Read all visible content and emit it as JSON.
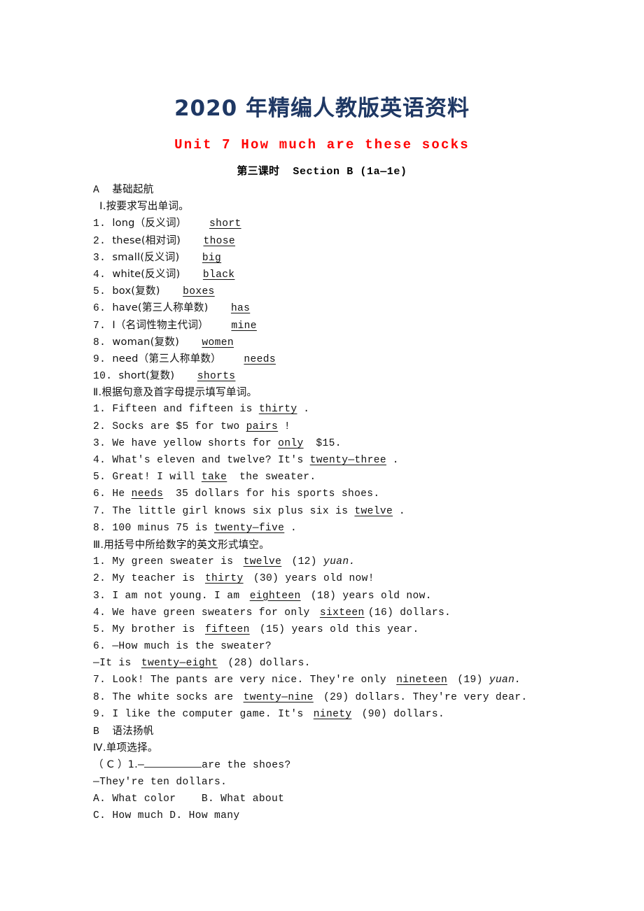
{
  "banner": "2020 年精编人教版英语资料",
  "unit_title": "Unit 7 How much are these socks",
  "subtitle_cn": "第三课时",
  "subtitle_en": "Section B (1a—1e)",
  "colors": {
    "banner": "#1f3864",
    "title": "#ff0000",
    "text": "#111111"
  },
  "section_a": {
    "letter": "A",
    "name": "基础起航"
  },
  "part1": {
    "heading_num": "Ⅰ",
    "heading": ".按要求写出单词。",
    "items": [
      {
        "num": "1.",
        "prompt": "long（反义词）",
        "answer": "short"
      },
      {
        "num": "2.",
        "prompt": "these(相对词)",
        "answer": "those"
      },
      {
        "num": "3.",
        "prompt": "small(反义词)",
        "answer": "big"
      },
      {
        "num": "4.",
        "prompt": "white(反义词)",
        "answer": "black"
      },
      {
        "num": "5.",
        "prompt": "box(复数)",
        "answer": "boxes"
      },
      {
        "num": "6.",
        "prompt": "have(第三人称单数)",
        "answer": "has"
      },
      {
        "num": "7.",
        "prompt": "I（名词性物主代词）",
        "answer": "mine"
      },
      {
        "num": "8.",
        "prompt": "woman(复数)",
        "answer": "women"
      },
      {
        "num": "9.",
        "prompt": "need（第三人称单数）",
        "answer": "needs"
      },
      {
        "num": "10.",
        "prompt": "short(复数)",
        "answer": "shorts"
      }
    ]
  },
  "part2": {
    "heading_num": "Ⅱ",
    "heading": ".根据句意及首字母提示填写单词。",
    "items": [
      {
        "num": "1.",
        "before": "Fifteen and fifteen is ",
        "answer": "thirty",
        "after": "."
      },
      {
        "num": "2.",
        "before": "Socks are $5 for two ",
        "answer": "pairs",
        "after": "!"
      },
      {
        "num": "3.",
        "before": "We have yellow shorts for ",
        "answer": "only",
        "after": " $15."
      },
      {
        "num": "4.",
        "before": "What's eleven and twelve? It's ",
        "answer": "twenty—three",
        "after": "."
      },
      {
        "num": "5.",
        "before": "Great! I will ",
        "answer": "take",
        "after": " the sweater."
      },
      {
        "num": "6.",
        "before": "He ",
        "answer": "needs",
        "after": " 35 dollars for his sports shoes."
      },
      {
        "num": "7.",
        "before": "The little girl knows six plus six is ",
        "answer": "twelve",
        "after": "."
      },
      {
        "num": "8.",
        "before": "100 minus 75 is ",
        "answer": "twenty—five",
        "after": "."
      }
    ]
  },
  "part3": {
    "heading_num": "Ⅲ",
    "heading": ".用括号中所给数字的英文形式填空。",
    "items": [
      {
        "num": "1.",
        "before": "My green sweater is ",
        "answer": "twelve",
        "after": " (12) ",
        "italic": "yuan."
      },
      {
        "num": "2.",
        "before": "My teacher is ",
        "answer": "thirty",
        "after": " (30) years old now!",
        "italic": ""
      },
      {
        "num": "3.",
        "before": "I am not young. I am ",
        "answer": "eighteen",
        "after": " (18) years old now.",
        "italic": ""
      },
      {
        "num": "4.",
        "before": "We have green sweaters for only ",
        "answer": "sixteen",
        "after": "(16) dollars.",
        "italic": ""
      },
      {
        "num": "5.",
        "before": "My brother is ",
        "answer": "fifteen",
        "after": " (15) years old this year.",
        "italic": ""
      }
    ],
    "item6_q": {
      "num": "6.",
      "text": "—How much is the sweater?"
    },
    "item6_a": {
      "before": "—It is ",
      "answer": "twenty—eight",
      "after": " (28) dollars."
    },
    "items_tail": [
      {
        "num": "7.",
        "before": "Look! The pants are very nice. They're only ",
        "answer": "nineteen",
        "after": " (19) ",
        "italic": "yuan."
      },
      {
        "num": "8.",
        "before": "The white socks are ",
        "answer": "twenty—nine",
        "after": " (29) dollars. They're very dear.",
        "italic": ""
      },
      {
        "num": "9.",
        "before": "I like the computer game. It's ",
        "answer": "ninety",
        "after": " (90) dollars.",
        "italic": ""
      }
    ]
  },
  "section_b": {
    "letter": "B",
    "name": "语法扬帆"
  },
  "part4": {
    "heading_num": "Ⅳ",
    "heading": ".单项选择。",
    "q1_answer": "（ C ）1.",
    "q1_stem_before": "—",
    "q1_stem_after": "are the shoes?",
    "q1_reply": "—They're ten dollars.",
    "choice_a": "A. What color",
    "choice_b": "B. What about",
    "choice_c": "C. How much",
    "choice_d": "D. How many"
  }
}
